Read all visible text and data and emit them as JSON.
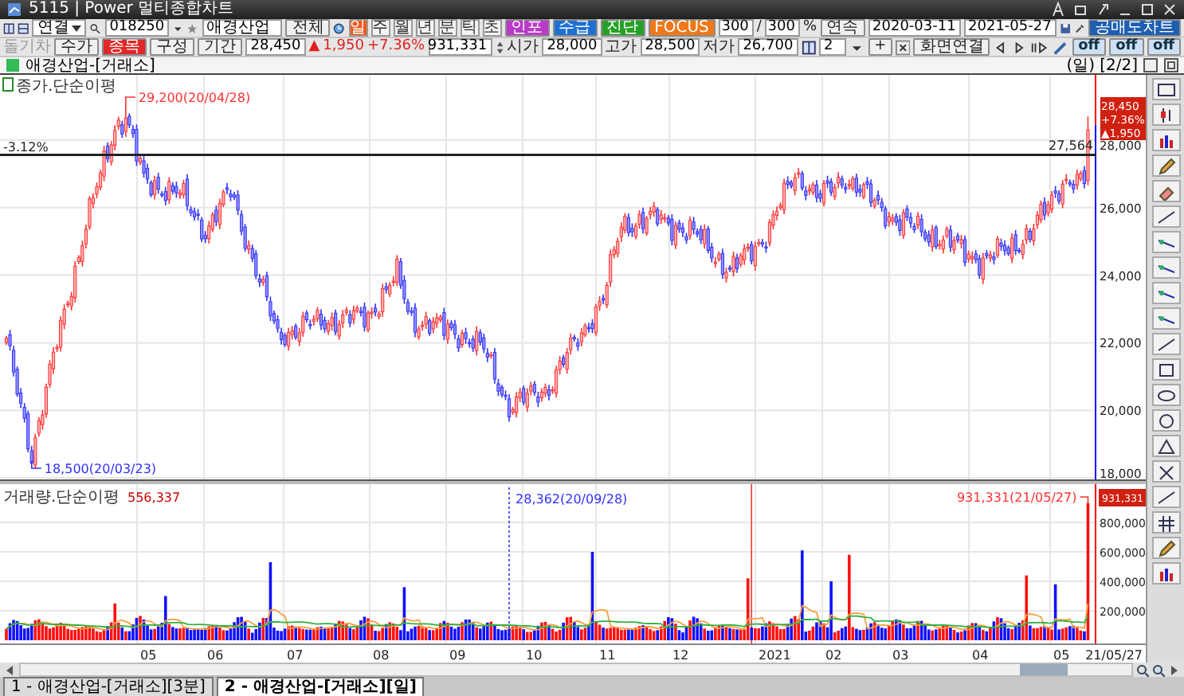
{
  "window": {
    "title": "5115 | Power 멀티종합차트"
  },
  "toolbar": {
    "market": "연결",
    "code": "018250",
    "name": "애경산업",
    "all_button": "전체",
    "periods": [
      {
        "label": "일",
        "selected": true
      },
      {
        "label": "주",
        "selected": false
      },
      {
        "label": "월",
        "selected": false
      },
      {
        "label": "년",
        "selected": false
      },
      {
        "label": "분",
        "selected": false
      },
      {
        "label": "틱",
        "selected": false
      },
      {
        "label": "초",
        "selected": false
      }
    ],
    "feature_buttons": [
      {
        "label": "인포",
        "color": "#b83cc8"
      },
      {
        "label": "수급",
        "color": "#1e70d0"
      },
      {
        "label": "진단",
        "color": "#28a028"
      },
      {
        "label": "FOCUS",
        "color": "#f07818"
      }
    ],
    "count_shown": "300",
    "separator": "/",
    "count_total": "300",
    "unit": "%",
    "continuous": "연속",
    "date_from": "2020-03-11",
    "date_to": "2021-05-27",
    "short_sale_chart": "공매도차트"
  },
  "quote_bar": {
    "disabled_label": "돌기차",
    "view_buttons": [
      {
        "label": "수가",
        "selected": false
      },
      {
        "label": "종목",
        "selected": true
      },
      {
        "label": "구성",
        "selected": false
      },
      {
        "label": "기간",
        "selected": false
      }
    ],
    "price": "28,450",
    "change_sign": "▲",
    "change": "1,950",
    "change_rate": "+7.36%",
    "volume": "931,331",
    "quotes": [
      {
        "label": "시가",
        "value": "28,000"
      },
      {
        "label": "고가",
        "value": "28,500"
      },
      {
        "label": "저가",
        "value": "26,700"
      }
    ],
    "layout_count": "2",
    "plus": "+",
    "screen_link": "화면연결",
    "toggles": [
      "off",
      "off",
      "off"
    ]
  },
  "chart_header": {
    "title": "애경산업-[거래소]",
    "period": "(일)",
    "page": "[2/2]"
  },
  "price_pane": {
    "legend": "종가.단순이평",
    "y_labels": [
      "28,000",
      "26,000",
      "24,000",
      "22,000",
      "20,000",
      "18,000"
    ],
    "high_label": "29,200(20/04/28)",
    "low_label": "18,500(20/03/23)",
    "ref_rate": "-3.12%",
    "ref_value": "27,564",
    "badge": [
      "28,450",
      "+7.36%",
      "▲1,950"
    ]
  },
  "volume_pane": {
    "legend": "거래량.단순이평",
    "legend_value": "556,337",
    "y_labels": [
      "800,000",
      "600,000",
      "400,000",
      "200,000"
    ],
    "max_label": "931,331(21/05/27)",
    "marker_label": "28,362(20/09/28)",
    "badge": "931,331"
  },
  "x_axis": [
    "05",
    "06",
    "07",
    "08",
    "09",
    "10",
    "11",
    "12",
    "2021",
    "02",
    "03",
    "04",
    "05",
    "21/05/27"
  ],
  "tabs": [
    {
      "label": "1 - 애경산업-[거래소][3분]",
      "selected": false
    },
    {
      "label": "2 - 애경산업-[거래소][일]",
      "selected": true
    }
  ]
}
